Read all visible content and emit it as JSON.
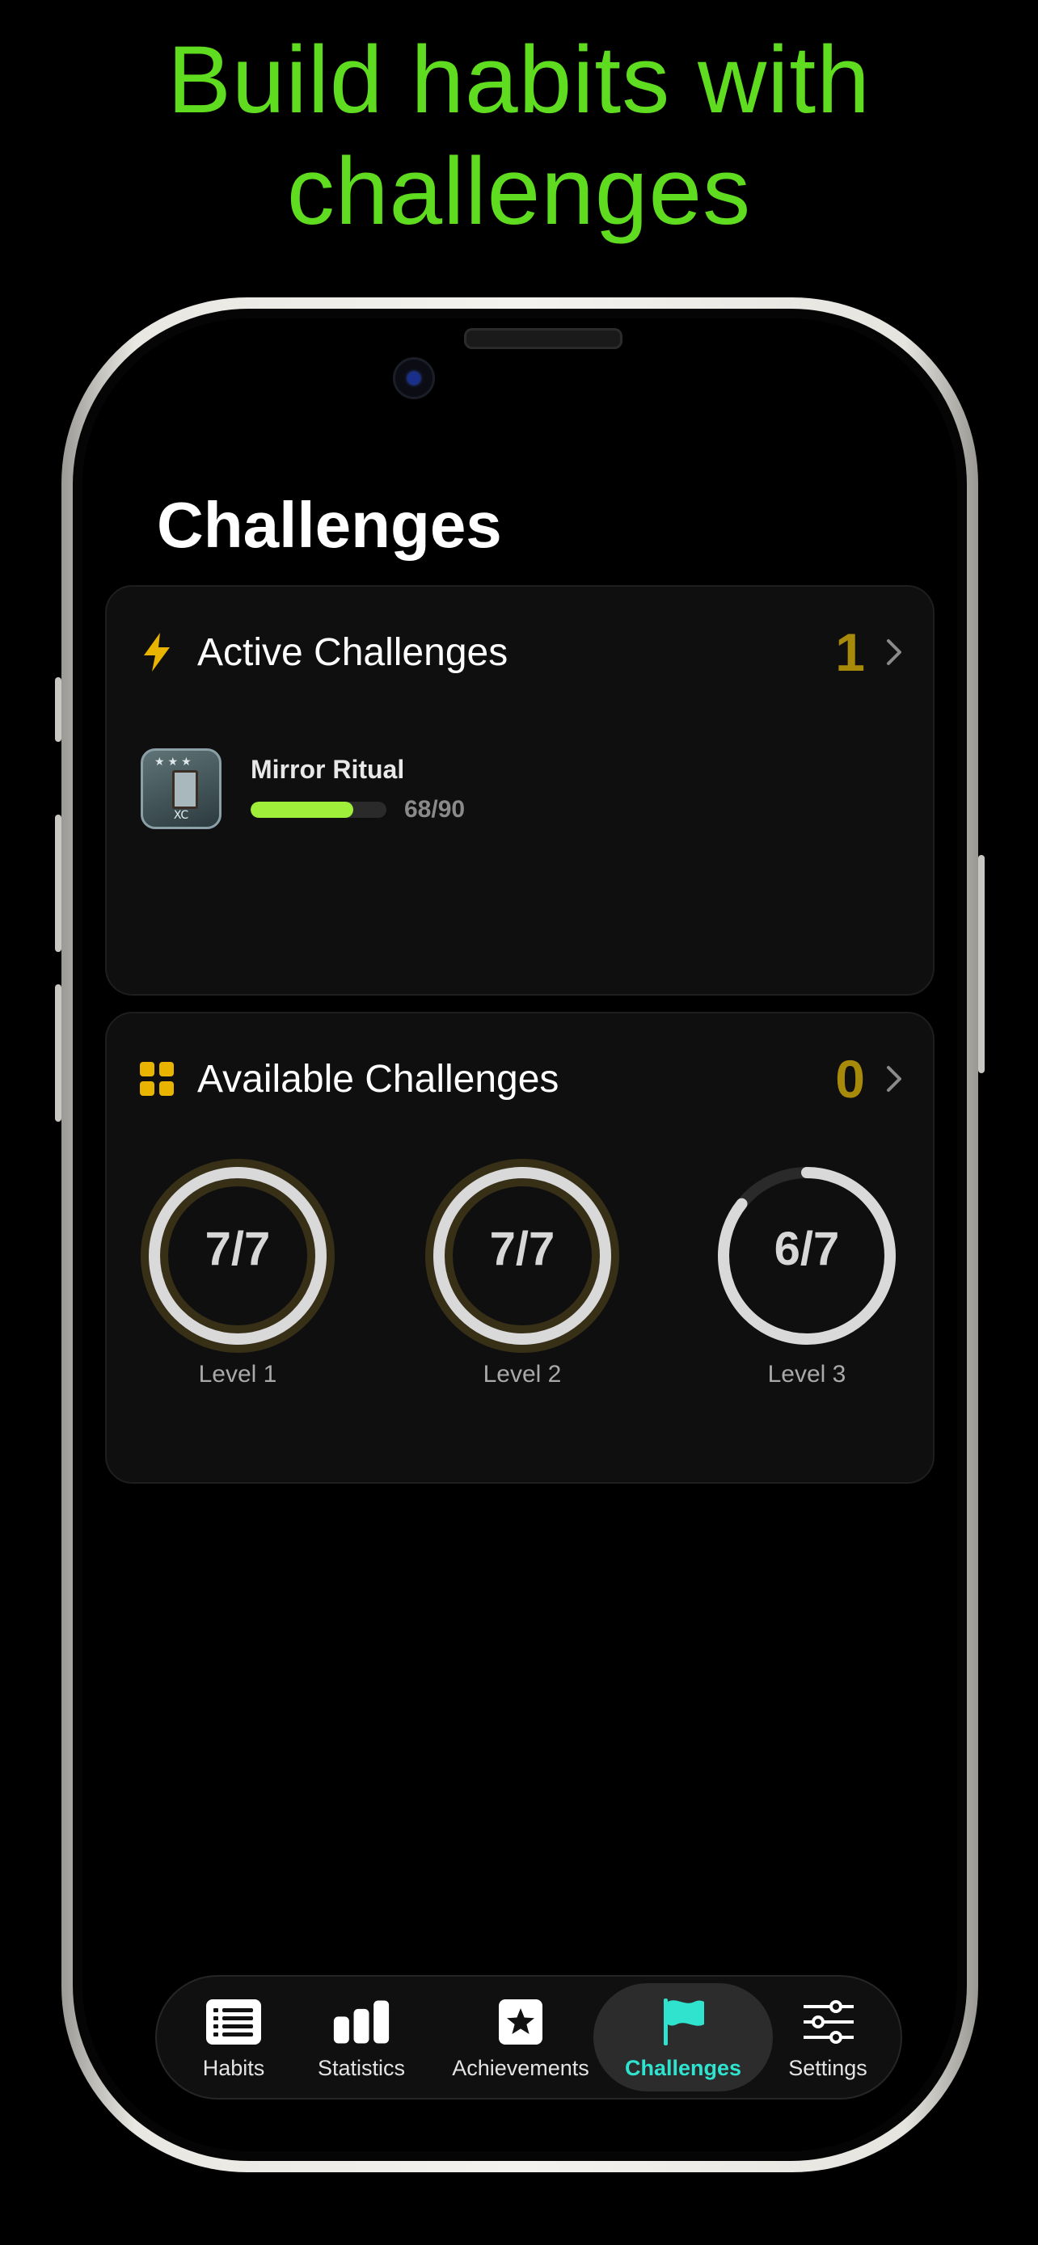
{
  "headline": "Build habits with challenges",
  "screen": {
    "title": "Challenges"
  },
  "active_challenges": {
    "title": "Active Challenges",
    "count": "1",
    "items": [
      {
        "name": "Mirror Ritual",
        "progress_text": "68/90",
        "progress": 0.756,
        "thumb_tag": "XC"
      }
    ]
  },
  "available_challenges": {
    "title": "Available Challenges",
    "count": "0",
    "levels": [
      {
        "ring_text": "7/7",
        "label": "Level 1",
        "fraction": 1.0
      },
      {
        "ring_text": "7/7",
        "label": "Level 2",
        "fraction": 1.0
      },
      {
        "ring_text": "6/7",
        "label": "Level 3",
        "fraction": 0.857
      }
    ]
  },
  "tabbar": {
    "tabs": [
      {
        "label": "Habits",
        "icon": "list-icon"
      },
      {
        "label": "Statistics",
        "icon": "bar-chart-icon"
      },
      {
        "label": "Achievements",
        "icon": "star-icon"
      },
      {
        "label": "Challenges",
        "icon": "flag-icon",
        "active": true
      },
      {
        "label": "Settings",
        "icon": "sliders-icon"
      }
    ]
  },
  "colors": {
    "headline": "#5fdc1f",
    "count": "#a88a0a",
    "progress": "#9fef3a",
    "active_tab": "#2fe3cf",
    "icon_yellow": "#e8b400"
  }
}
